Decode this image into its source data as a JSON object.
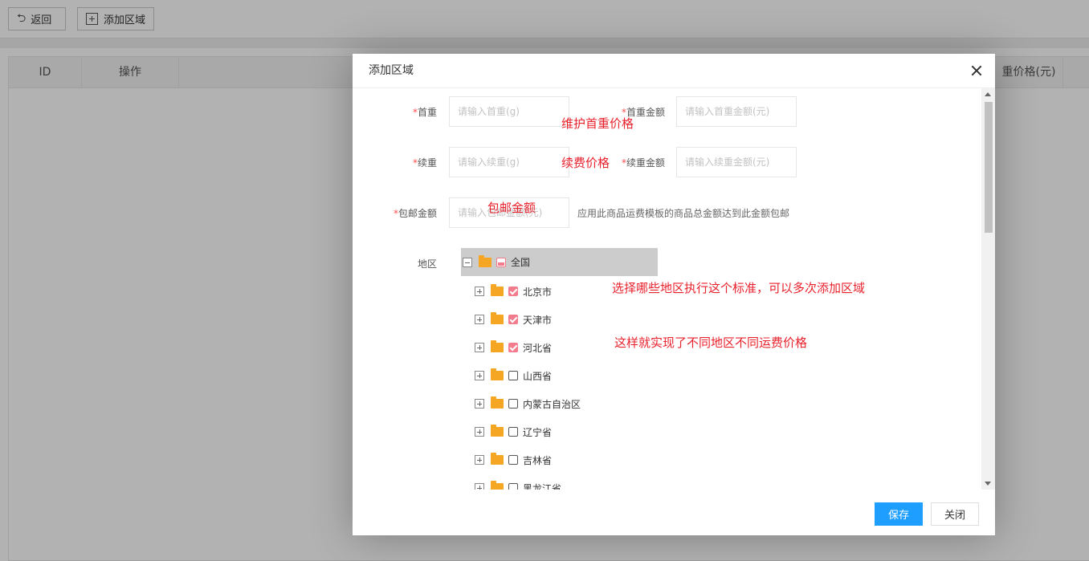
{
  "toolbar": {
    "back_label": "返回",
    "add_region_label": "添加区域"
  },
  "grid": {
    "headers": [
      "ID",
      "操作",
      "重价格(元)"
    ]
  },
  "dialog": {
    "title": "添加区域",
    "fields": {
      "first_weight": {
        "required_mark": "*",
        "label": "首重",
        "placeholder": "请输入首重(g)"
      },
      "first_amount": {
        "required_mark": "*",
        "label": "首重金额",
        "placeholder": "请输入首重金额(元)"
      },
      "extra_weight": {
        "required_mark": "*",
        "label": "续重",
        "placeholder": "请输入续重(g)"
      },
      "extra_amount": {
        "required_mark": "*",
        "label": "续重金额",
        "placeholder": "请输入续重金额(元)"
      },
      "free_amount": {
        "required_mark": "*",
        "label": "包邮金额",
        "placeholder": "请输入包邮金额(元)",
        "hint": "应用此商品运费模板的商品总金额达到此金额包邮"
      }
    },
    "region_label": "地区",
    "tree": {
      "root": {
        "label": "全国",
        "state": "partial"
      },
      "children": [
        {
          "label": "北京市",
          "checked": true
        },
        {
          "label": "天津市",
          "checked": true
        },
        {
          "label": "河北省",
          "checked": true
        },
        {
          "label": "山西省",
          "checked": false
        },
        {
          "label": "内蒙古自治区",
          "checked": false
        },
        {
          "label": "辽宁省",
          "checked": false
        },
        {
          "label": "吉林省",
          "checked": false
        },
        {
          "label": "黑龙江省",
          "checked": false
        }
      ]
    },
    "annotations": {
      "a1": "维护首重价格",
      "a2": "续费价格",
      "a3": "包邮金额",
      "a4": "选择哪些地区执行这个标准，可以多次添加区域",
      "a5": "这样就实现了不同地区不同运费价格"
    },
    "save_label": "保存",
    "close_label": "关闭"
  },
  "colors": {
    "primary": "#1e9fff",
    "annotation": "#e8222d",
    "checkbox": "#f27b8c",
    "folder": "#f5a623"
  }
}
